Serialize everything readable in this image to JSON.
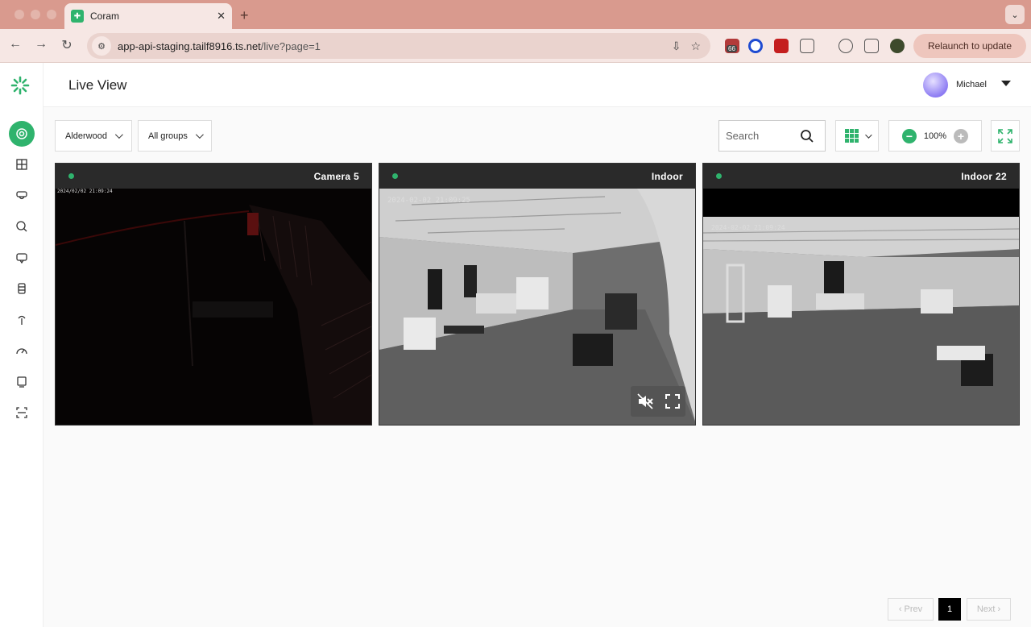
{
  "browser": {
    "tab_title": "Coram",
    "url_host": "app-api-staging.tailf8916.ts.net",
    "url_path": "/live?page=1",
    "extension_badge": "66",
    "relaunch_label": "Relaunch to update"
  },
  "app": {
    "page_title": "Live View",
    "user_name": "Michael",
    "accent_color": "#2fb36d",
    "sidebar_icons": [
      "live-view-icon",
      "grid-icon",
      "camera-icon",
      "search-icon",
      "chat-icon",
      "storage-icon",
      "sensor-icon",
      "dashboard-icon",
      "device-icon",
      "scan-icon"
    ]
  },
  "filters": {
    "location": "Alderwood",
    "group": "All groups",
    "search_placeholder": "Search",
    "zoom": "100%"
  },
  "cameras": [
    {
      "name": "Camera 5",
      "timestamp": "2024/02/02 21:09:24",
      "status": "online"
    },
    {
      "name": "Indoor",
      "timestamp": "2024-02-02 21:09:25",
      "status": "online"
    },
    {
      "name": "Indoor 22",
      "timestamp": "2024-02-02 21:09:24",
      "status": "online"
    }
  ],
  "pagination": {
    "prev": "Prev",
    "current": "1",
    "next": "Next"
  }
}
